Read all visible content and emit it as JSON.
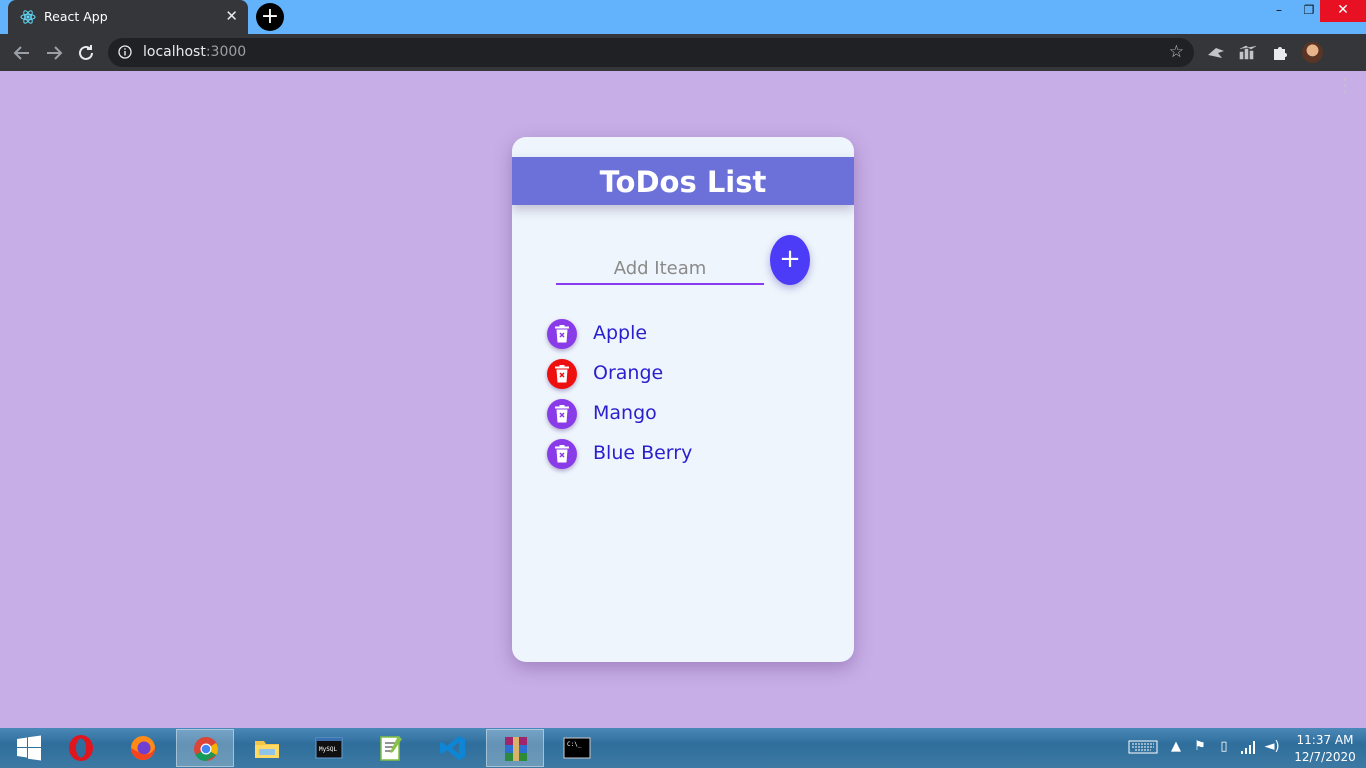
{
  "browser": {
    "tab_title": "React App",
    "tab_close": "✕",
    "new_tab": "+",
    "url_host": "localhost",
    "url_port": ":3000",
    "window_controls": {
      "minimize": "–",
      "maximize": "❐",
      "close": "✕"
    }
  },
  "app": {
    "title": "ToDos List",
    "input_placeholder": "Add Iteam",
    "add_button_label": "+",
    "items": [
      {
        "text": "Apple"
      },
      {
        "text": "Orange"
      },
      {
        "text": "Mango"
      },
      {
        "text": "Blue Berry"
      }
    ],
    "colors": {
      "page_background": "#c8aee6",
      "header": "#6c71d9",
      "add_button": "#4c3cf7",
      "delete_button": "#8a3be8",
      "delete_button_hover": "#ee0f0f",
      "item_text": "#2a1fcf"
    }
  },
  "taskbar": {
    "apps": [
      "windows-start",
      "opera",
      "firefox",
      "chrome",
      "file-explorer",
      "mysql",
      "notepad-plus-plus",
      "vscode",
      "winrar",
      "command-prompt"
    ],
    "active_apps": [
      "chrome",
      "notepad-plus-plus"
    ],
    "clock": {
      "time": "11:37 AM",
      "date": "12/7/2020"
    }
  }
}
